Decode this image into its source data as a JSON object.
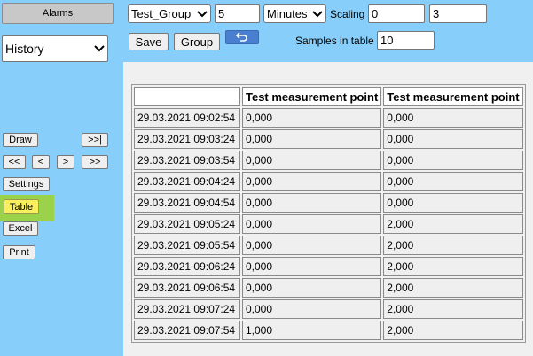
{
  "sidebar": {
    "alarms_label": "Alarms",
    "view_select": "History",
    "draw_label": "Draw",
    "end_label": ">>|",
    "first_label": "<<",
    "prev_label": "<",
    "next_label": ">",
    "last_label": ">>",
    "settings_label": "Settings",
    "table_label": "Table",
    "excel_label": "Excel",
    "print_label": "Print",
    "active_highlight": "#9ad34a"
  },
  "toolbar": {
    "group_select": "Test_Group",
    "period_value": "5",
    "unit_select": "Minutes",
    "scaling_label": "Scaling",
    "scaling_min": "0",
    "scaling_max": "3",
    "save_label": "Save",
    "group_label": "Group",
    "samples_label": "Samples in table",
    "samples_value": "10",
    "undo_icon": "undo-icon"
  },
  "table": {
    "headers": [
      "",
      "Test measurement point",
      "Test measurement point"
    ],
    "rows": [
      [
        "29.03.2021 09:02:54",
        "0,000",
        "0,000"
      ],
      [
        "29.03.2021 09:03:24",
        "0,000",
        "0,000"
      ],
      [
        "29.03.2021 09:03:54",
        "0,000",
        "0,000"
      ],
      [
        "29.03.2021 09:04:24",
        "0,000",
        "0,000"
      ],
      [
        "29.03.2021 09:04:54",
        "0,000",
        "0,000"
      ],
      [
        "29.03.2021 09:05:24",
        "0,000",
        "2,000"
      ],
      [
        "29.03.2021 09:05:54",
        "0,000",
        "2,000"
      ],
      [
        "29.03.2021 09:06:24",
        "0,000",
        "2,000"
      ],
      [
        "29.03.2021 09:06:54",
        "0,000",
        "2,000"
      ],
      [
        "29.03.2021 09:07:24",
        "0,000",
        "2,000"
      ],
      [
        "29.03.2021 09:07:54",
        "1,000",
        "2,000"
      ]
    ]
  },
  "colors": {
    "background": "#87cefa",
    "panel": "#f0f0f0",
    "undo_button": "#4a7fcf"
  }
}
